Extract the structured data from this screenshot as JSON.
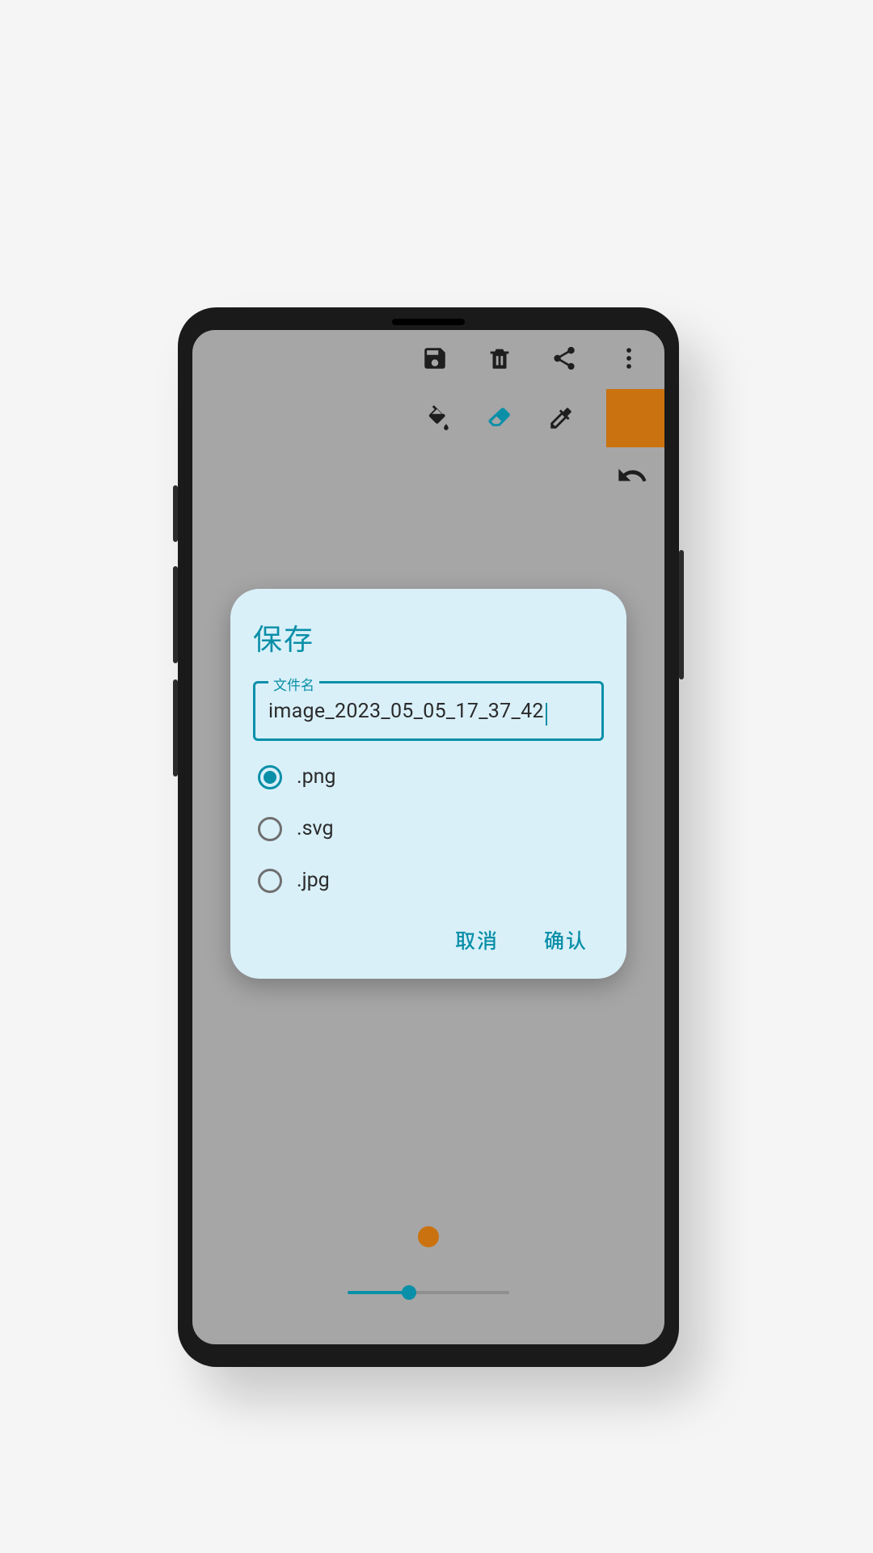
{
  "colors": {
    "accent": "#0a8fa8",
    "swatch": "#c9720f"
  },
  "appbar": {
    "save_icon": "save-icon",
    "delete_icon": "trash-icon",
    "share_icon": "share-icon",
    "overflow_icon": "more-vert-icon"
  },
  "tools": {
    "fill_icon": "paint-bucket-icon",
    "eraser_icon": "eraser-icon",
    "eyedropper_icon": "eyedropper-icon",
    "undo_icon": "undo-icon"
  },
  "dialog": {
    "title": "保存",
    "filename_label": "文件名",
    "filename_value": "image_2023_05_05_17_37_42",
    "formats": [
      {
        "label": ".png",
        "checked": true
      },
      {
        "label": ".svg",
        "checked": false
      },
      {
        "label": ".jpg",
        "checked": false
      }
    ],
    "cancel_label": "取消",
    "confirm_label": "确认"
  }
}
